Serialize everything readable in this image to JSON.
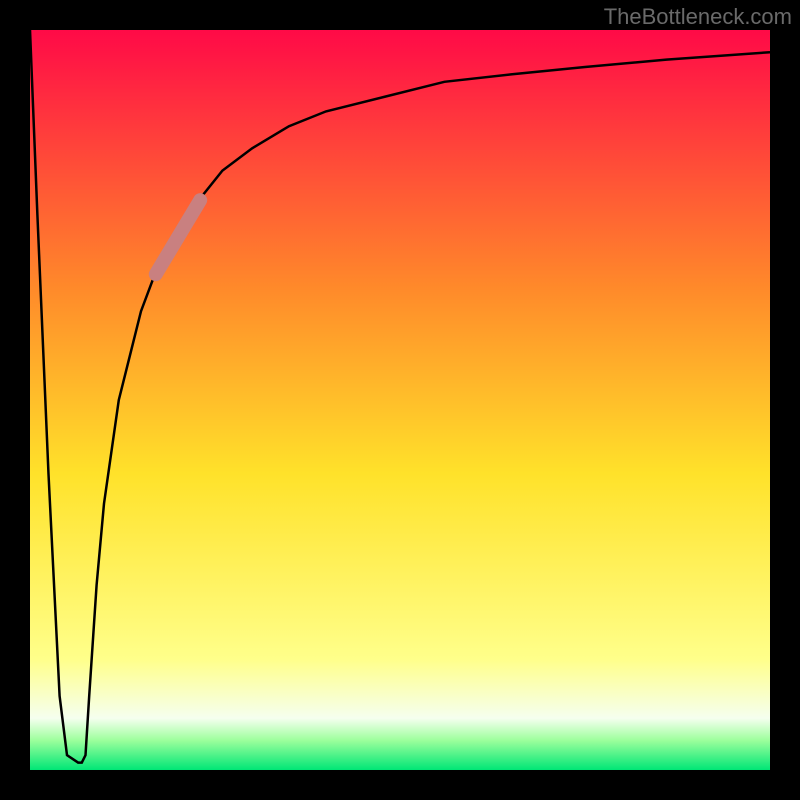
{
  "attribution": "TheBottleneck.com",
  "chart_data": {
    "type": "line",
    "title": "",
    "xlabel": "",
    "ylabel": "",
    "xlim": [
      0,
      100
    ],
    "ylim": [
      0,
      100
    ],
    "gradient_stops": [
      {
        "offset": 0,
        "color": "#ff0a47"
      },
      {
        "offset": 35,
        "color": "#ff8a2a"
      },
      {
        "offset": 60,
        "color": "#ffe22a"
      },
      {
        "offset": 85,
        "color": "#ffff8a"
      },
      {
        "offset": 93,
        "color": "#f5ffef"
      },
      {
        "offset": 96,
        "color": "#9cff9c"
      },
      {
        "offset": 100,
        "color": "#00e676"
      }
    ],
    "series": [
      {
        "name": "bottleneck-curve",
        "x": [
          0,
          1,
          2.5,
          4,
          5,
          6.5,
          7.0,
          7.5,
          8,
          9,
          10,
          12,
          15,
          18,
          22,
          26,
          30,
          35,
          40,
          48,
          56,
          65,
          75,
          86,
          100
        ],
        "y": [
          100,
          75,
          40,
          10,
          2,
          1,
          1,
          2,
          10,
          25,
          36,
          50,
          62,
          70,
          76,
          81,
          84,
          87,
          89,
          91,
          93,
          94,
          95,
          96,
          97
        ]
      }
    ],
    "highlight_segment": {
      "series": "bottleneck-curve",
      "x": [
        17,
        23
      ],
      "y": [
        67,
        77
      ],
      "color": "#c98080",
      "width": 14
    }
  }
}
